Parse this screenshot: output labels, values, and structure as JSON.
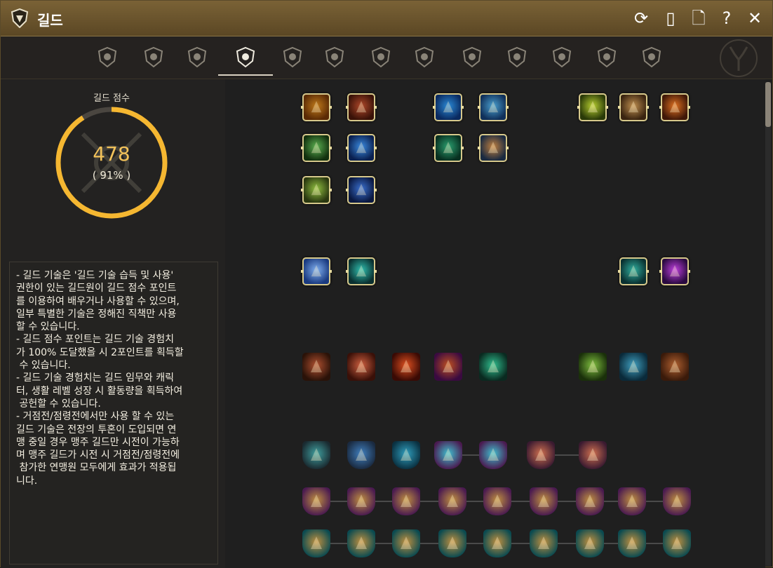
{
  "window": {
    "title": "길드"
  },
  "titlebar_buttons": [
    {
      "name": "refresh-icon",
      "glyph": "⟳"
    },
    {
      "name": "mobile-icon",
      "glyph": "▯"
    },
    {
      "name": "document-icon",
      "glyph": "🗋"
    },
    {
      "name": "help-icon",
      "glyph": "?"
    },
    {
      "name": "close-icon",
      "glyph": "✕"
    }
  ],
  "tabs": [
    {
      "name": "guild-info-icon"
    },
    {
      "name": "guild-members-icon"
    },
    {
      "name": "guild-quest-icon"
    },
    {
      "name": "guild-skills-icon",
      "active": true
    },
    {
      "name": "guild-tower-icon"
    },
    {
      "name": "guild-notice-icon"
    },
    {
      "name": "guild-bell-icon"
    },
    {
      "name": "guild-war-icon"
    },
    {
      "name": "guild-shield-icon"
    },
    {
      "name": "guild-emblem-icon"
    },
    {
      "name": "guild-contract-icon"
    },
    {
      "name": "guild-fleur-icon"
    },
    {
      "name": "guild-mask-icon"
    }
  ],
  "score": {
    "label": "길드 점수",
    "value": "478",
    "percent_text": "( 91% )",
    "percent": 0.91
  },
  "description": [
    "- 길드 기술은 '길드 기술 습득 및 사용'",
    "권한이 있는 길드원이 길드 점수 포인트",
    "를 이용하여 배우거나 사용할 수 있으며,",
    "일부 특별한 기술은 정해진 직책만 사용",
    "할 수 있습니다.",
    "- 길드 점수 포인트는 길드 기술 경험치",
    "가 100% 도달했을 시 2포인트를 획득할",
    " 수 있습니다.",
    "- 길드 기술 경험치는 길드 임무와 캐릭",
    "터, 생활 레벨 성장 시 활동량을 획득하여",
    " 공헌할 수 있습니다.",
    "- 거점전/점령전에서만 사용 할 수 있는",
    "길드 기술은 전장의 투혼이 도입되면 연",
    "맹 중일 경우 맹주 길드만 시전이 가능하",
    "며 맹주 길드가 시전 시 거점전/점령전에",
    " 참가한 연맹원 모두에게 효과가 적용됩",
    "니다."
  ],
  "colors": {
    "accent": "#f5b731",
    "frame": "#d7c98c",
    "title_bg": "#6b5530"
  },
  "skills": [
    {
      "name": "shield-buff-skill-icon",
      "c1": "#c07a1a",
      "c2": "#5a2a05",
      "row": 0,
      "col": 0,
      "framed": true
    },
    {
      "name": "fire-burst-skill-icon",
      "c1": "#b0482a",
      "c2": "#3a1208",
      "row": 0,
      "col": 1,
      "framed": true
    },
    {
      "name": "ship-sail-skill-icon",
      "c1": "#2a8ad8",
      "c2": "#0a2a60",
      "row": 0,
      "col": 3,
      "framed": true
    },
    {
      "name": "ship-fleet-skill-icon",
      "c1": "#4aa0d0",
      "c2": "#10305a",
      "row": 0,
      "col": 4,
      "framed": true
    },
    {
      "name": "heal-cross-skill-icon",
      "c1": "#b8d030",
      "c2": "#2a3a08",
      "row": 0,
      "col": 6,
      "framed": true
    },
    {
      "name": "feather-skill-icon",
      "c1": "#c09050",
      "c2": "#3a2410",
      "row": 0,
      "col": 7,
      "framed": true
    },
    {
      "name": "flame-swirl-skill-icon",
      "c1": "#e07020",
      "c2": "#401808",
      "row": 0,
      "col": 8,
      "framed": true
    },
    {
      "name": "strength-skill-icon",
      "c1": "#5ab050",
      "c2": "#12300e",
      "row": 1,
      "col": 0,
      "framed": true
    },
    {
      "name": "spirit-skill-icon",
      "c1": "#3a8ae0",
      "c2": "#0a2050",
      "row": 1,
      "col": 1,
      "framed": true
    },
    {
      "name": "target-skill-icon",
      "c1": "#2aa070",
      "c2": "#083020",
      "row": 1,
      "col": 3,
      "framed": true
    },
    {
      "name": "galleon-skill-icon",
      "c1": "#c08040",
      "c2": "#1a2a40",
      "row": 1,
      "col": 4,
      "framed": true
    },
    {
      "name": "claw-skill-icon",
      "c1": "#90c040",
      "c2": "#2a3810",
      "row": 2,
      "col": 0,
      "framed": true
    },
    {
      "name": "armor-skill-icon",
      "c1": "#3a70d0",
      "c2": "#0a1840",
      "row": 2,
      "col": 1,
      "framed": true
    },
    {
      "name": "wing-skill-icon",
      "c1": "#80b0f0",
      "c2": "#1a3a80",
      "row": 3,
      "col": 0,
      "framed": true
    },
    {
      "name": "aura-warrior-skill-icon",
      "c1": "#30c0b0",
      "c2": "#0a3030",
      "row": 3,
      "col": 1,
      "framed": true
    },
    {
      "name": "water-orb-skill-icon",
      "c1": "#30b0a0",
      "c2": "#0a3030",
      "row": 3,
      "col": 7,
      "framed": true
    },
    {
      "name": "crystal-skill-icon",
      "c1": "#c040e0",
      "c2": "#2a0a40",
      "row": 3,
      "col": 8,
      "framed": true
    },
    {
      "name": "grab-skill-icon",
      "c1": "#b05030",
      "c2": "#2a1208",
      "row": 4,
      "col": 0,
      "framed": false
    },
    {
      "name": "sword-slash-skill-icon",
      "c1": "#d06040",
      "c2": "#3a1008",
      "row": 4,
      "col": 1,
      "framed": false
    },
    {
      "name": "flame-skill-icon",
      "c1": "#e05020",
      "c2": "#3a0a04",
      "row": 4,
      "col": 2,
      "framed": false
    },
    {
      "name": "vortex-skill-icon",
      "c1": "#c05020",
      "c2": "#3a0a40",
      "row": 4,
      "col": 3,
      "framed": false
    },
    {
      "name": "wind-slash-skill-icon",
      "c1": "#30c090",
      "c2": "#0a2a20",
      "row": 4,
      "col": 4,
      "framed": false
    },
    {
      "name": "leaf-skill-icon",
      "c1": "#80c040",
      "c2": "#1a300a",
      "row": 4,
      "col": 6,
      "framed": false
    },
    {
      "name": "water-beast-skill-icon",
      "c1": "#40a0c0",
      "c2": "#0a2a3a",
      "row": 4,
      "col": 7,
      "framed": false
    },
    {
      "name": "wheel-skill-icon",
      "c1": "#b06030",
      "c2": "#3a1a0a",
      "row": 4,
      "col": 8,
      "framed": false
    },
    {
      "name": "cannon-skill-icon",
      "c1": "#40a0a0",
      "c2": "#1a2a30",
      "row": 5,
      "col": 0,
      "framed": false,
      "shield": true
    },
    {
      "name": "repair-skill-icon",
      "c1": "#4080c0",
      "c2": "#1a2a40",
      "row": 5,
      "col": 1,
      "framed": false,
      "shield": true
    },
    {
      "name": "beast-rider-skill-icon",
      "c1": "#30a0c0",
      "c2": "#0a3040",
      "row": 5,
      "col": 2,
      "framed": false,
      "shield": true
    },
    {
      "name": "elephant-1-skill-icon",
      "c1": "#40c0d0",
      "c2": "#4a1a50",
      "row": 5,
      "col": 3,
      "framed": false,
      "shield": true
    },
    {
      "name": "elephant-2-skill-icon",
      "c1": "#40c0d0",
      "c2": "#4a1a50",
      "row": 5,
      "col": 4,
      "framed": false,
      "shield": true
    },
    {
      "name": "fist-1-skill-icon",
      "c1": "#d07050",
      "c2": "#3a1a30",
      "row": 5,
      "col": 5,
      "framed": false,
      "shield": true
    },
    {
      "name": "fist-2-skill-icon",
      "c1": "#d07050",
      "c2": "#3a1a30",
      "row": 5,
      "col": 6,
      "framed": false,
      "shield": true
    }
  ],
  "chest_rows": [
    {
      "name": "purple-chest-skill-icon",
      "c1": "#c09040",
      "c2": "#4a1a50",
      "row": 6,
      "count": 9
    },
    {
      "name": "teal-chest-skill-icon",
      "c1": "#c09040",
      "c2": "#0a4a50",
      "row": 7,
      "count": 9
    }
  ]
}
